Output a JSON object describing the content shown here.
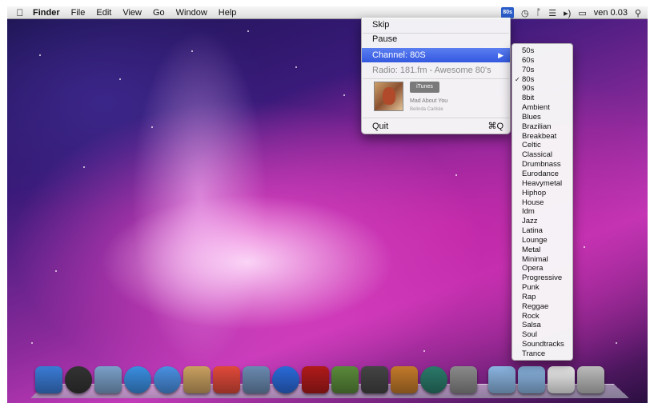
{
  "menubar": {
    "apple_icon": "apple-icon",
    "app_name": "Finder",
    "menus": [
      "File",
      "Edit",
      "View",
      "Go",
      "Window",
      "Help"
    ],
    "status_app_label": "80s",
    "clock": "ven 0.03"
  },
  "radio_menu": {
    "skip": "Skip",
    "pause": "Pause",
    "channel": "Channel: 80S",
    "station": "Radio: 181.fm - Awesome 80's",
    "itunes_button": "iTunes",
    "song_title": "Mad About You",
    "song_artist": "Belinda Carlisle",
    "quit": "Quit",
    "quit_shortcut": "⌘Q"
  },
  "channels": {
    "selected": "80s",
    "items": [
      "50s",
      "60s",
      "70s",
      "80s",
      "90s",
      "8bit",
      "Ambient",
      "Blues",
      "Brazilian",
      "Breakbeat",
      "Celtic",
      "Classical",
      "Drumbnass",
      "Eurodance",
      "Heavymetal",
      "Hiphop",
      "House",
      "Idm",
      "Jazz",
      "Latina",
      "Lounge",
      "Metal",
      "Minimal",
      "Opera",
      "Progressive",
      "Punk",
      "Rap",
      "Reggae",
      "Rock",
      "Salsa",
      "Soul",
      "Soundtracks",
      "Trance"
    ]
  },
  "dock": {
    "apps": [
      {
        "name": "finder-icon",
        "color": "#3a7bd5"
      },
      {
        "name": "dashboard-icon",
        "color": "#333333"
      },
      {
        "name": "mail-icon",
        "color": "#7aa0c8"
      },
      {
        "name": "safari-icon",
        "color": "#3a8ee0"
      },
      {
        "name": "ichat-icon",
        "color": "#4a90e2"
      },
      {
        "name": "address-book-icon",
        "color": "#c9a060"
      },
      {
        "name": "ical-icon",
        "color": "#e04a3a"
      },
      {
        "name": "preview-icon",
        "color": "#6a8ab0"
      },
      {
        "name": "itunes-icon",
        "color": "#2a6ad8"
      },
      {
        "name": "photo-booth-icon",
        "color": "#b01a1a"
      },
      {
        "name": "iphoto-icon",
        "color": "#5a8a3a"
      },
      {
        "name": "imovie-icon",
        "color": "#444444"
      },
      {
        "name": "garageband-icon",
        "color": "#c27a2a"
      },
      {
        "name": "time-machine-icon",
        "color": "#2a7a6a"
      },
      {
        "name": "system-preferences-icon",
        "color": "#8a8a8a"
      },
      {
        "name": "applications-folder-icon",
        "color": "#8ab4e0"
      },
      {
        "name": "documents-folder-icon",
        "color": "#8ab4e0"
      },
      {
        "name": "pdf-document-icon",
        "color": "#eeeeee"
      },
      {
        "name": "trash-icon",
        "color": "#bbbbbb"
      }
    ]
  }
}
